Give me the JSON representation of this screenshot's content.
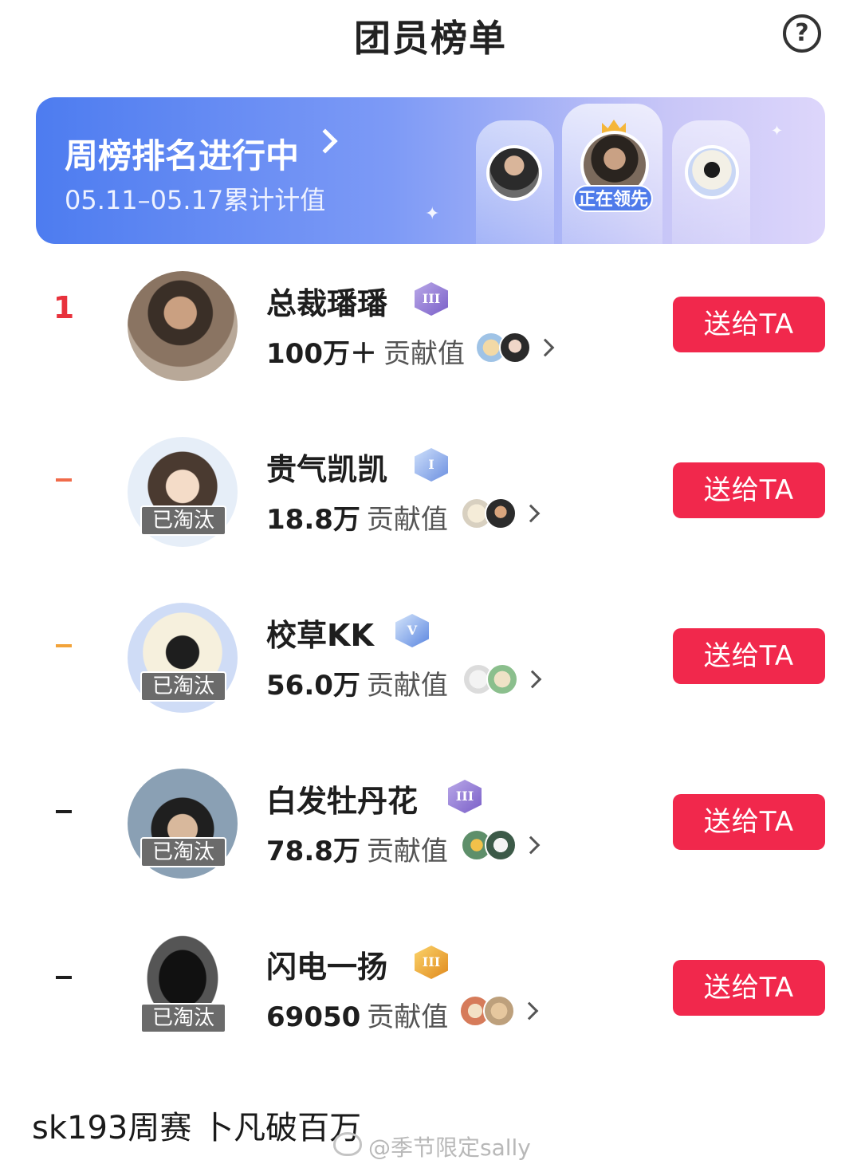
{
  "header": {
    "title": "团员榜单",
    "help_label": "?"
  },
  "banner": {
    "title": "周榜排名进行中",
    "date_range": "05.11–05.17累计计值",
    "leading_badge": "正在领先"
  },
  "members": [
    {
      "rank": "1",
      "name": "总裁璠璠",
      "level": "III",
      "contribution": "100万＋",
      "contribution_label": "贡献值",
      "eliminated": false,
      "gift_label": "送给TA"
    },
    {
      "rank": "–",
      "name": "贵气凯凯",
      "level": "I",
      "contribution": "18.8万",
      "contribution_label": "贡献值",
      "eliminated": true,
      "eliminated_label": "已淘汰",
      "gift_label": "送给TA"
    },
    {
      "rank": "–",
      "name": "校草KK",
      "level": "V",
      "contribution": "56.0万",
      "contribution_label": "贡献值",
      "eliminated": true,
      "eliminated_label": "已淘汰",
      "gift_label": "送给TA"
    },
    {
      "rank": "–",
      "name": "白发牡丹花",
      "level": "III",
      "contribution": "78.8万",
      "contribution_label": "贡献值",
      "eliminated": true,
      "eliminated_label": "已淘汰",
      "gift_label": "送给TA"
    },
    {
      "rank": "–",
      "name": "闪电一扬",
      "level": "III",
      "contribution": "69050",
      "contribution_label": "贡献值",
      "eliminated": true,
      "eliminated_label": "已淘汰",
      "gift_label": "送给TA"
    }
  ],
  "caption": "sk193周赛 卜凡破百万",
  "watermark": "@季节限定sally",
  "colors": {
    "accent": "#f1284c",
    "banner_start": "#4d7cf0",
    "banner_end": "#ddd6fb",
    "rank1": "#e8323c",
    "rank2": "#f06b4a",
    "rank3": "#f2a33a"
  }
}
